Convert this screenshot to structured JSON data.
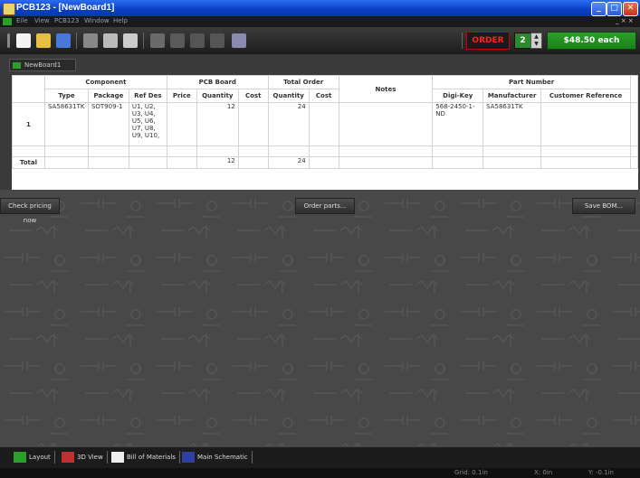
{
  "window": {
    "title": "PCB123 - [NewBoard1]",
    "buttons": [
      "_",
      "□",
      "✕"
    ]
  },
  "menu": {
    "items": [
      "Eile",
      "View",
      "PCB123",
      "Window",
      "Help"
    ],
    "right": "_ × ×"
  },
  "order": {
    "label": "ORDER",
    "quantity": "2",
    "price": "$48.50 each"
  },
  "doc_tab": {
    "label": "NewBoard1"
  },
  "bom": {
    "group_headers": {
      "component": "Component",
      "pcb_board": "PCB Board",
      "total_order": "Total Order",
      "notes": "Notes",
      "part_number": "Part Number"
    },
    "columns": {
      "type": "Type",
      "package": "Package",
      "ref_des": "Ref Des",
      "price": "Price",
      "quantity": "Quantity",
      "cost": "Cost",
      "total_quantity": "Quantity",
      "total_cost": "Cost",
      "digikey": "Digi-Key",
      "manufacturer": "Manufacturer",
      "customer_ref": "Customer Reference"
    },
    "row": {
      "num": "1",
      "type": "SA58631TK",
      "package": "SOT909-1",
      "ref_des": "U1, U2, U3, U4, U5, U6, U7, U8, U9, U10,",
      "price": "",
      "quantity": "12",
      "cost": "",
      "total_quantity": "24",
      "total_cost": "",
      "notes": "",
      "digikey": "568-2450-1-ND",
      "manufacturer": "SA58631TK",
      "customer_ref": ""
    },
    "total": {
      "label": "Total",
      "quantity": "12",
      "total_quantity": "24"
    }
  },
  "actions": {
    "check_pricing": "Check pricing now",
    "order_parts": "Order parts...",
    "save_bom": "Save BOM..."
  },
  "bottom_tabs": [
    {
      "label": "Layout",
      "icon": "layout-icon"
    },
    {
      "label": "3D View",
      "icon": "3d-view-icon"
    },
    {
      "label": "Bill of Materials",
      "icon": "bom-icon"
    },
    {
      "label": "Main Schematic",
      "icon": "schematic-icon"
    }
  ],
  "status": {
    "grid": "Grid: 0.1in",
    "x": "X: 0in",
    "y": "Y: -0.1in"
  }
}
